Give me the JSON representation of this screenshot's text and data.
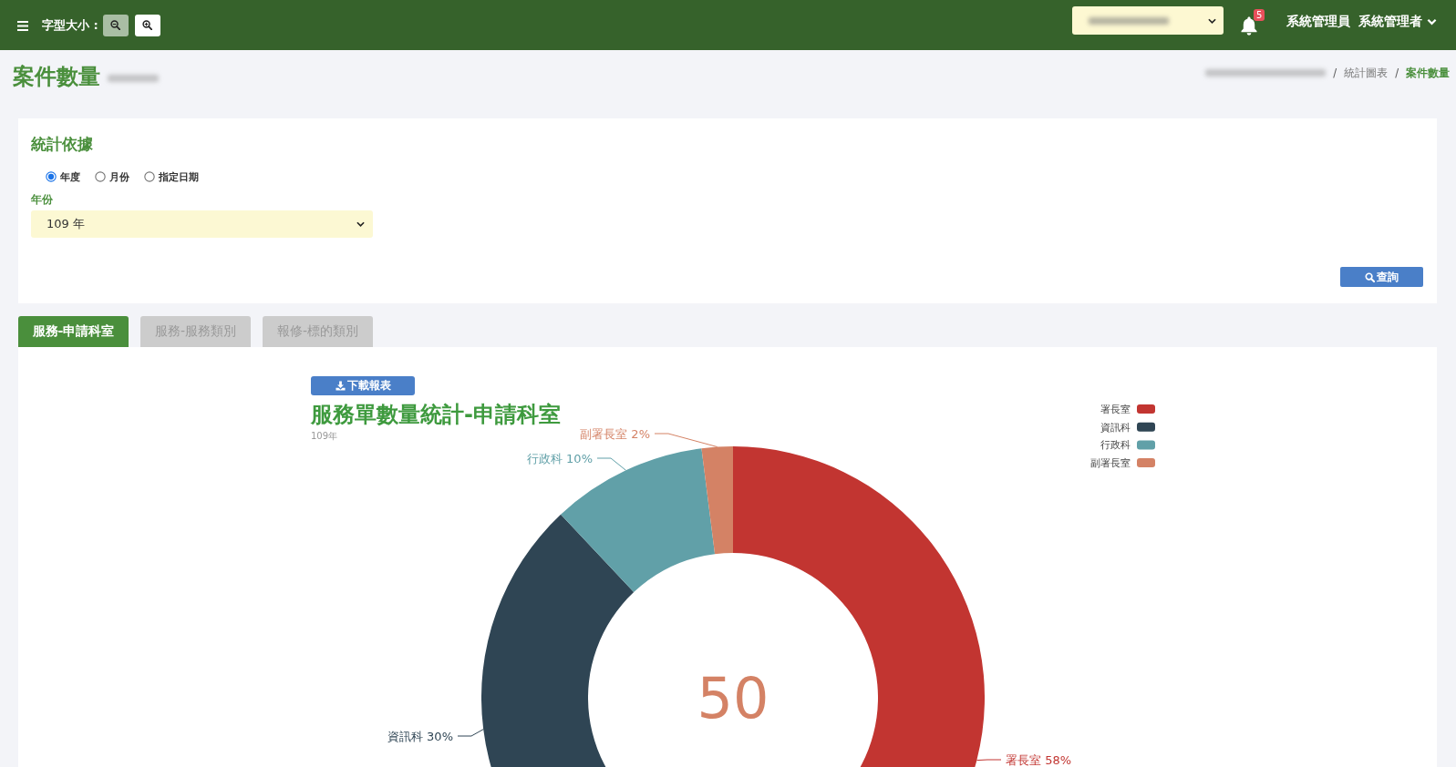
{
  "topbar": {
    "font_size_label": "字型大小 :",
    "font_buttons": [
      {
        "kind": "zoom-out",
        "disabled": true
      },
      {
        "kind": "zoom-in",
        "disabled": false
      }
    ],
    "notification_count": "5",
    "user_role": "系統管理員",
    "user_name": "系統管理者"
  },
  "page": {
    "title": "案件數量",
    "breadcrumb": [
      {
        "separator": "/",
        "label": "統計圖表",
        "current": false
      },
      {
        "separator": "/",
        "label": "案件數量",
        "current": true
      }
    ]
  },
  "filter": {
    "title": "統計依據",
    "basis": [
      {
        "label": "年度",
        "selected": true
      },
      {
        "label": "月份",
        "selected": false
      },
      {
        "label": "指定日期",
        "selected": false
      }
    ],
    "year_label": "年份",
    "year_value": "109 年",
    "query_button": "查詢"
  },
  "tabs": [
    {
      "label": "服務-申請科室",
      "selected": true
    },
    {
      "label": "服務-服務類別",
      "selected": false
    },
    {
      "label": "報修-標的類別",
      "selected": false
    }
  ],
  "chart": {
    "download_button": "下載報表",
    "subtitle": "109年",
    "total": "50",
    "slice_labels": [
      "署長室 58%",
      "資訊科 30%",
      "行政科 10%",
      "副署長室 2%"
    ],
    "chart_data": {
      "type": "donut",
      "title": "服務單數量統計-申請科室",
      "categories": [
        "署長室",
        "資訊科",
        "行政科",
        "副署長室"
      ],
      "values": [
        58,
        30,
        10,
        2
      ],
      "colors": [
        "#c23531",
        "#2f4554",
        "#61a0a8",
        "#d48265"
      ],
      "legend": "right"
    }
  }
}
